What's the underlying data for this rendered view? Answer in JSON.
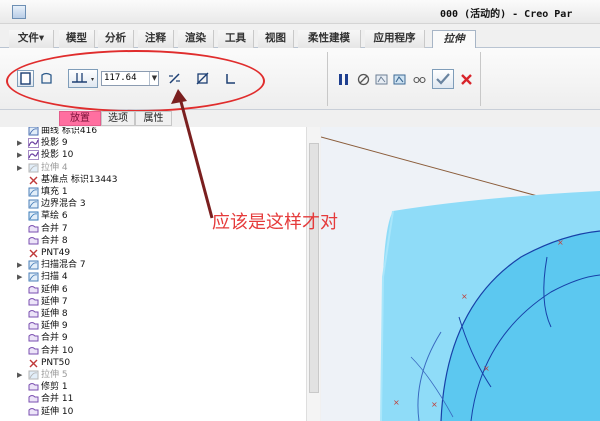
{
  "window": {
    "title": "000 (活动的) - Creo Par"
  },
  "menu": {
    "tabs": [
      {
        "label": "文件▾"
      },
      {
        "label": "模型"
      },
      {
        "label": "分析"
      },
      {
        "label": "注释"
      },
      {
        "label": "渲染"
      },
      {
        "label": "工具"
      },
      {
        "label": "视图"
      },
      {
        "label": "柔性建模"
      },
      {
        "label": "应用程序"
      },
      {
        "label": "拉伸"
      }
    ]
  },
  "ribbon": {
    "depth_value": "117.64",
    "icons": [
      "solid-icon",
      "surface-icon",
      "depth-to-selected-icon",
      "flip-direction-icon",
      "remove-material-icon",
      "thicken-icon",
      "pause-icon",
      "no-preview-icon",
      "geometry-preview-icon",
      "feature-preview-icon",
      "glasses-icon",
      "ok-icon",
      "cancel-icon"
    ]
  },
  "subtabs": [
    {
      "label": "放置"
    },
    {
      "label": "选项"
    },
    {
      "label": "属性"
    }
  ],
  "tree": {
    "rows": [
      {
        "label": "曲线 标识416",
        "icon": "curve-icon",
        "expander": "",
        "dim": false
      },
      {
        "label": "投影 9",
        "icon": "projection-icon",
        "expander": "▶",
        "dim": false
      },
      {
        "label": "投影 10",
        "icon": "projection-icon",
        "expander": "▶",
        "dim": false
      },
      {
        "label": "拉伸 4",
        "icon": "extrude-icon",
        "expander": "▶",
        "dim": true
      },
      {
        "label": "基准点 标识13443",
        "icon": "datum-point-icon",
        "expander": "",
        "dim": false
      },
      {
        "label": "填充 1",
        "icon": "fill-icon",
        "expander": "",
        "dim": false
      },
      {
        "label": "边界混合 3",
        "icon": "boundary-blend-icon",
        "expander": "",
        "dim": false
      },
      {
        "label": "草绘 6",
        "icon": "sketch-icon",
        "expander": "",
        "dim": false
      },
      {
        "label": "合并 7",
        "icon": "merge-icon",
        "expander": "",
        "dim": false
      },
      {
        "label": "合并 8",
        "icon": "merge-icon",
        "expander": "",
        "dim": false
      },
      {
        "label": "PNT49",
        "icon": "datum-point-icon",
        "expander": "",
        "dim": false
      },
      {
        "label": "扫描混合 7",
        "icon": "swept-blend-icon",
        "expander": "▶",
        "dim": false
      },
      {
        "label": "扫描 4",
        "icon": "sweep-icon",
        "expander": "▶",
        "dim": false
      },
      {
        "label": "延伸 6",
        "icon": "extend-icon",
        "expander": "",
        "dim": false
      },
      {
        "label": "延伸 7",
        "icon": "extend-icon",
        "expander": "",
        "dim": false
      },
      {
        "label": "延伸 8",
        "icon": "extend-icon",
        "expander": "",
        "dim": false
      },
      {
        "label": "延伸 9",
        "icon": "extend-icon",
        "expander": "",
        "dim": false
      },
      {
        "label": "合并 9",
        "icon": "merge-icon",
        "expander": "",
        "dim": false
      },
      {
        "label": "合并 10",
        "icon": "merge-icon",
        "expander": "",
        "dim": false
      },
      {
        "label": "PNT50",
        "icon": "datum-point-icon",
        "expander": "",
        "dim": false
      },
      {
        "label": "拉伸 5",
        "icon": "extrude-icon",
        "expander": "▶",
        "dim": true
      },
      {
        "label": "修剪 1",
        "icon": "trim-icon",
        "expander": "",
        "dim": false
      },
      {
        "label": "合并 11",
        "icon": "merge-icon",
        "expander": "",
        "dim": false
      },
      {
        "label": "延伸 10",
        "icon": "extend-icon",
        "expander": "",
        "dim": false
      }
    ]
  },
  "annotation": {
    "text": "应该是这样才对"
  },
  "colors": {
    "annotation_red": "#e53b3b",
    "model_surface": "#6fd3f6",
    "highlight_pink": "#ff6fa0"
  }
}
